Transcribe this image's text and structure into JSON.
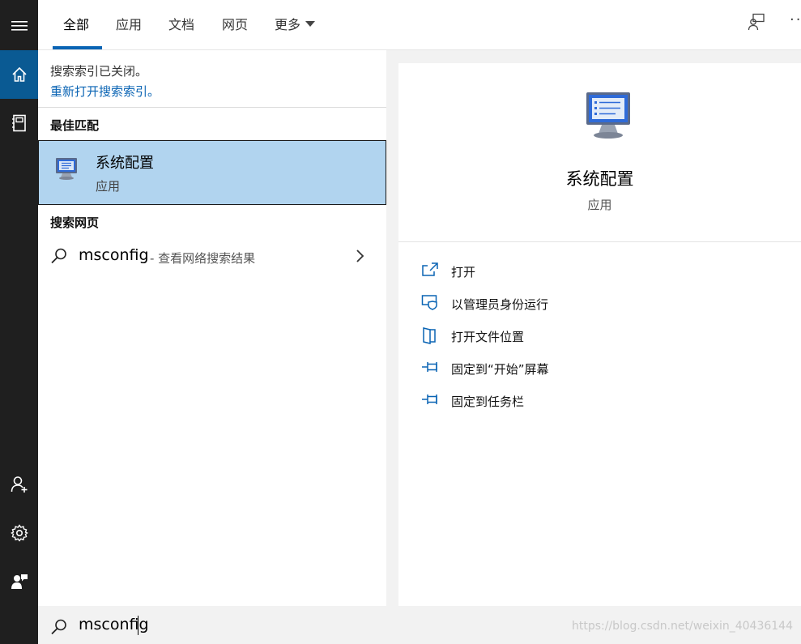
{
  "sidebar": {
    "items": [
      {
        "icon": "hamburger-menu-icon"
      },
      {
        "icon": "home-icon",
        "active": true
      },
      {
        "icon": "notebook-icon"
      },
      {
        "icon": "add-person-icon"
      },
      {
        "icon": "gear-icon"
      },
      {
        "icon": "feedback-person-icon"
      }
    ]
  },
  "tabs": {
    "items": [
      {
        "label": "全部",
        "active": true
      },
      {
        "label": "应用"
      },
      {
        "label": "文档"
      },
      {
        "label": "网页"
      },
      {
        "label": "更多"
      }
    ],
    "feedback_icon": "feedback-icon",
    "more_icon": "ellipsis-icon"
  },
  "left": {
    "index_message": "搜索索引已关闭。",
    "index_link": "重新打开搜索索引。",
    "best_match_header": "最佳匹配",
    "best_match": {
      "title": "系统配置",
      "subtitle": "应用",
      "icon": "system-config-monitor-icon"
    },
    "web_header": "搜索网页",
    "web_result": {
      "query": "msconfig",
      "hint": "- 查看网络搜索结果"
    }
  },
  "detail": {
    "title": "系统配置",
    "subtitle": "应用",
    "actions": [
      {
        "label": "打开",
        "icon": "open-icon"
      },
      {
        "label": "以管理员身份运行",
        "icon": "run-as-admin-icon"
      },
      {
        "label": "打开文件位置",
        "icon": "file-location-icon"
      },
      {
        "label": "固定到“开始”屏幕",
        "icon": "pin-icon"
      },
      {
        "label": "固定到任务栏",
        "icon": "pin-taskbar-icon"
      }
    ]
  },
  "search": {
    "value": "msconfig"
  },
  "watermark": "https://blog.csdn.net/weixin_40436144",
  "colors": {
    "accent": "#0a64b4",
    "sidebar": "#1f1f1f",
    "sidebar_active": "#0a5a93",
    "selection": "#b1d4ef"
  }
}
